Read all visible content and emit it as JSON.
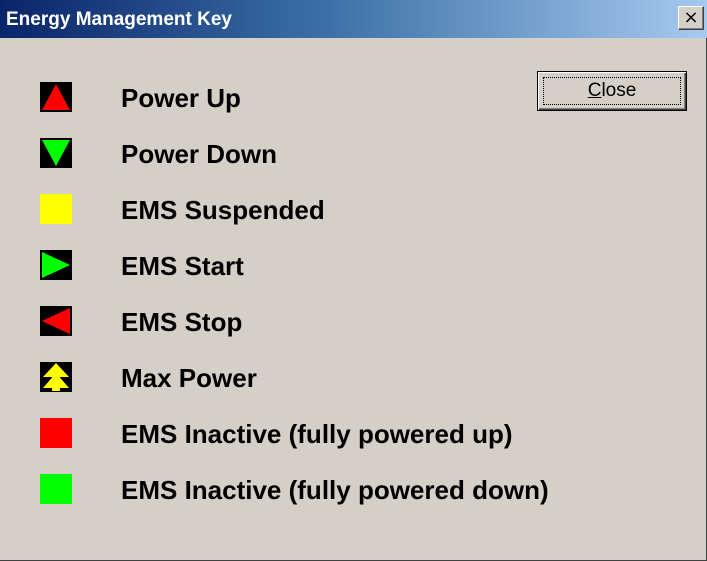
{
  "window": {
    "title": "Energy Management Key",
    "close_glyph": "×"
  },
  "close_button": {
    "mnemonic": "C",
    "rest": "lose"
  },
  "legend": [
    {
      "label": "Power Up",
      "icon": "power-up-icon",
      "fill": "#ff0000",
      "bg": "#000000"
    },
    {
      "label": "Power Down",
      "icon": "power-down-icon",
      "fill": "#00ff00",
      "bg": "#000000"
    },
    {
      "label": "EMS Suspended",
      "icon": "ems-suspended-icon",
      "fill": "#ffff00"
    },
    {
      "label": "EMS Start",
      "icon": "ems-start-icon",
      "fill": "#00ff00",
      "bg": "#000000"
    },
    {
      "label": "EMS Stop",
      "icon": "ems-stop-icon",
      "fill": "#ff0000",
      "bg": "#000000"
    },
    {
      "label": "Max Power",
      "icon": "max-power-icon",
      "fill": "#ffff00",
      "bg": "#000000"
    },
    {
      "label": "EMS Inactive (fully powered up)",
      "icon": "ems-inactive-up-icon",
      "fill": "#ff0000"
    },
    {
      "label": "EMS Inactive (fully powered down)",
      "icon": "ems-inactive-down-icon",
      "fill": "#00ff00"
    }
  ]
}
